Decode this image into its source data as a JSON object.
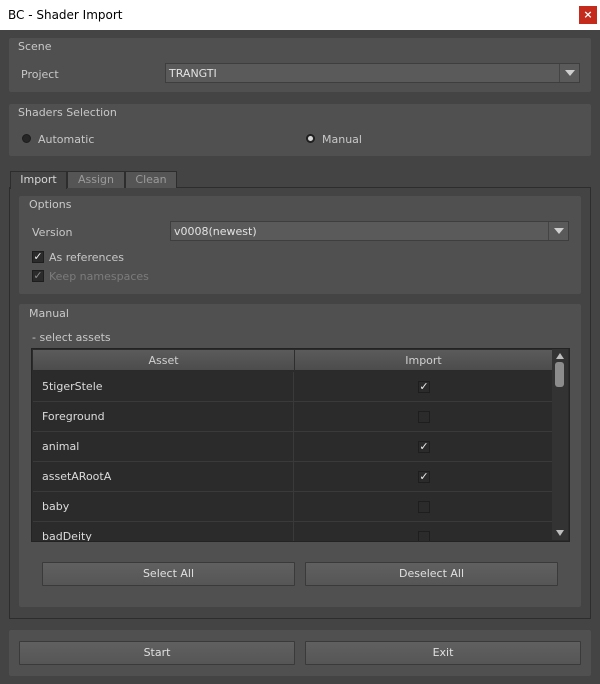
{
  "window": {
    "title": "BC - Shader Import",
    "close_glyph": "×"
  },
  "scene": {
    "header": "Scene",
    "project_label": "Project",
    "project_value": "TRANGTI"
  },
  "shaders_selection": {
    "header": "Shaders Selection",
    "options": [
      {
        "label": "Automatic",
        "selected": false
      },
      {
        "label": "Manual",
        "selected": true
      }
    ]
  },
  "tabs": [
    {
      "label": "Import",
      "active": true
    },
    {
      "label": "Assign",
      "active": false
    },
    {
      "label": "Clean",
      "active": false
    }
  ],
  "options": {
    "header": "Options",
    "version_label": "Version",
    "version_value": "v0008(newest)",
    "as_references": {
      "label": "As references",
      "checked": true,
      "enabled": true
    },
    "keep_namespaces": {
      "label": "Keep namespaces",
      "checked": true,
      "enabled": false
    }
  },
  "manual": {
    "header": "Manual",
    "subheader": "- select assets",
    "columns": [
      "Asset",
      "Import"
    ],
    "rows": [
      {
        "asset": "5tigerStele",
        "import": true
      },
      {
        "asset": "Foreground",
        "import": false
      },
      {
        "asset": "animal",
        "import": true
      },
      {
        "asset": "assetARootA",
        "import": true
      },
      {
        "asset": "baby",
        "import": false
      },
      {
        "asset": "badDeity",
        "import": false
      }
    ],
    "select_all": "Select All",
    "deselect_all": "Deselect All"
  },
  "footer": {
    "start": "Start",
    "exit": "Exit"
  },
  "colors": {
    "background": "#444444",
    "panel": "#505050",
    "close": "#c42b1c",
    "table_bg": "#2b2b2b"
  }
}
